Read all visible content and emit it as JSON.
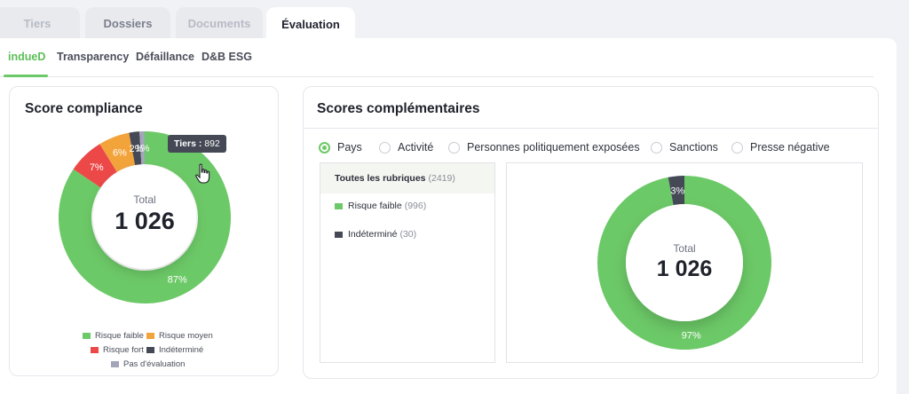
{
  "top_tabs": [
    {
      "label": "Tiers"
    },
    {
      "label": "Dossiers"
    },
    {
      "label": "Documents"
    },
    {
      "label": "Évaluation"
    }
  ],
  "sub_tabs": [
    {
      "label": "indueD"
    },
    {
      "label": "Transparency"
    },
    {
      "label": "Défaillance"
    },
    {
      "label": "D&B ESG"
    }
  ],
  "score_compliance": {
    "title": "Score compliance",
    "total_label": "Total",
    "total_value": "1 026",
    "tooltip": {
      "label": "Tiers :",
      "value": "892"
    },
    "legend": [
      {
        "label": "Risque faible",
        "color": "#6cc967"
      },
      {
        "label": "Risque moyen",
        "color": "#f2a33a"
      },
      {
        "label": "Risque fort",
        "color": "#ec4848"
      },
      {
        "label": "Indéterminé",
        "color": "#444955"
      },
      {
        "label": "Pas d'évaluation",
        "color": "#a3a6b8"
      }
    ]
  },
  "scores_complementaires": {
    "title": "Scores complémentaires",
    "radios": [
      {
        "label": "Pays",
        "selected": true
      },
      {
        "label": "Activité",
        "selected": false
      },
      {
        "label": "Personnes politiquement exposées",
        "selected": false
      },
      {
        "label": "Sanctions",
        "selected": false
      },
      {
        "label": "Presse négative",
        "selected": false
      }
    ],
    "rubriques": {
      "all": {
        "label": "Toutes les rubriques",
        "count": "(2419)"
      },
      "items": [
        {
          "label": "Risque faible",
          "count": "(996)",
          "color": "#6cc967"
        },
        {
          "label": "Indéterminé",
          "count": "(30)",
          "color": "#444955"
        }
      ]
    },
    "total_label": "Total",
    "total_value": "1 026"
  },
  "chart_data": [
    {
      "type": "pie",
      "title": "Score compliance",
      "categories": [
        "Risque faible",
        "Risque fort",
        "Risque moyen",
        "Indéterminé",
        "Pas d'évaluation"
      ],
      "values": [
        87,
        7,
        6,
        2,
        1
      ],
      "value_labels": [
        "87%",
        "7%",
        "6%",
        "2%",
        "1%"
      ],
      "colors": [
        "#6cc967",
        "#ec4848",
        "#f2a33a",
        "#444955",
        "#a3a6b8"
      ],
      "legend": "bottom"
    },
    {
      "type": "pie",
      "title": "Scores complémentaires",
      "categories": [
        "Risque faible",
        "Indéterminé"
      ],
      "values": [
        97,
        3
      ],
      "value_labels": [
        "97%",
        "3%"
      ],
      "colors": [
        "#6cc967",
        "#444955"
      ],
      "legend": "left"
    }
  ]
}
